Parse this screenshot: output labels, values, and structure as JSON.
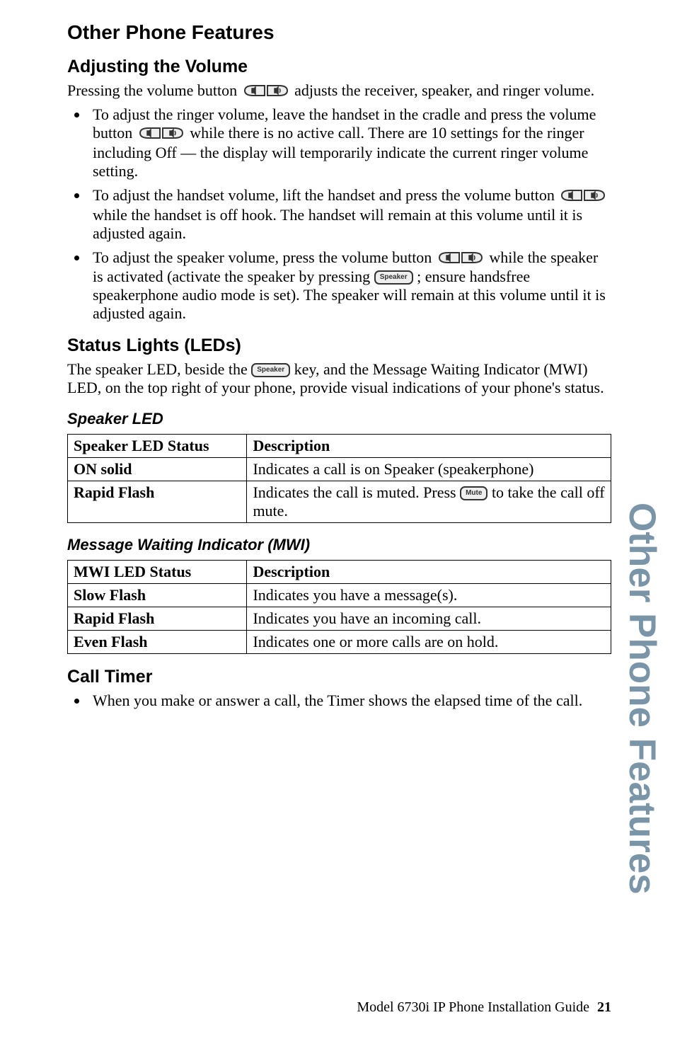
{
  "h1": "Other Phone Features",
  "adjusting": {
    "title": "Adjusting the Volume",
    "intro_a": "Pressing the volume button ",
    "intro_b": " adjusts the receiver, speaker, and ringer volume.",
    "bullets": {
      "b1a": "To adjust the ringer volume, leave the handset in the cradle and press the volume button ",
      "b1b": " while there is no active call. There are 10 settings for the ringer including Off — the display will temporarily indicate the current ringer volume setting.",
      "b2a": "To adjust the handset volume, lift the handset and press the volume button ",
      "b2b": " while the handset is off hook. The handset will remain at this volume until it is adjusted again.",
      "b3a": "To adjust the speaker volume, press the volume button ",
      "b3b": " while the speaker is activated (activate the speaker by pressing ",
      "b3c": " ; ensure handsfree speakerphone audio mode is set). The speaker will remain at this volume until it is adjusted again."
    }
  },
  "status": {
    "title": "Status Lights (LEDs)",
    "intro_a": "The speaker LED, beside the ",
    "intro_b": " key, and the Message Waiting Indicator (MWI) LED, on the top right of your phone, provide visual indications of your phone's status."
  },
  "speaker_led": {
    "title": "Speaker LED",
    "headers": {
      "c1": "Speaker LED Status",
      "c2": "Description"
    },
    "rows": [
      {
        "c1": "ON solid",
        "c2": "Indicates a call is on Speaker (speakerphone)"
      },
      {
        "c1": "Rapid Flash",
        "c2a": "Indicates the call is muted. Press ",
        "c2b": " to take the call off mute."
      }
    ]
  },
  "mwi": {
    "title": "Message Waiting Indicator (MWI)",
    "headers": {
      "c1": "MWI LED Status",
      "c2": "Description"
    },
    "rows": [
      {
        "c1": "Slow Flash",
        "c2": "Indicates you have a message(s)."
      },
      {
        "c1": "Rapid Flash",
        "c2": "Indicates you have an incoming call."
      },
      {
        "c1": "Even Flash",
        "c2": "Indicates one or more calls are on hold."
      }
    ]
  },
  "calltimer": {
    "title": "Call Timer",
    "bullet": "When you make or answer a call, the Timer shows the elapsed time of the call."
  },
  "keys": {
    "speaker": "Speaker",
    "mute": "Mute"
  },
  "sidetab": "Other Phone Features",
  "footer": {
    "text": "Model 6730i IP Phone Installation Guide",
    "page": "21"
  }
}
